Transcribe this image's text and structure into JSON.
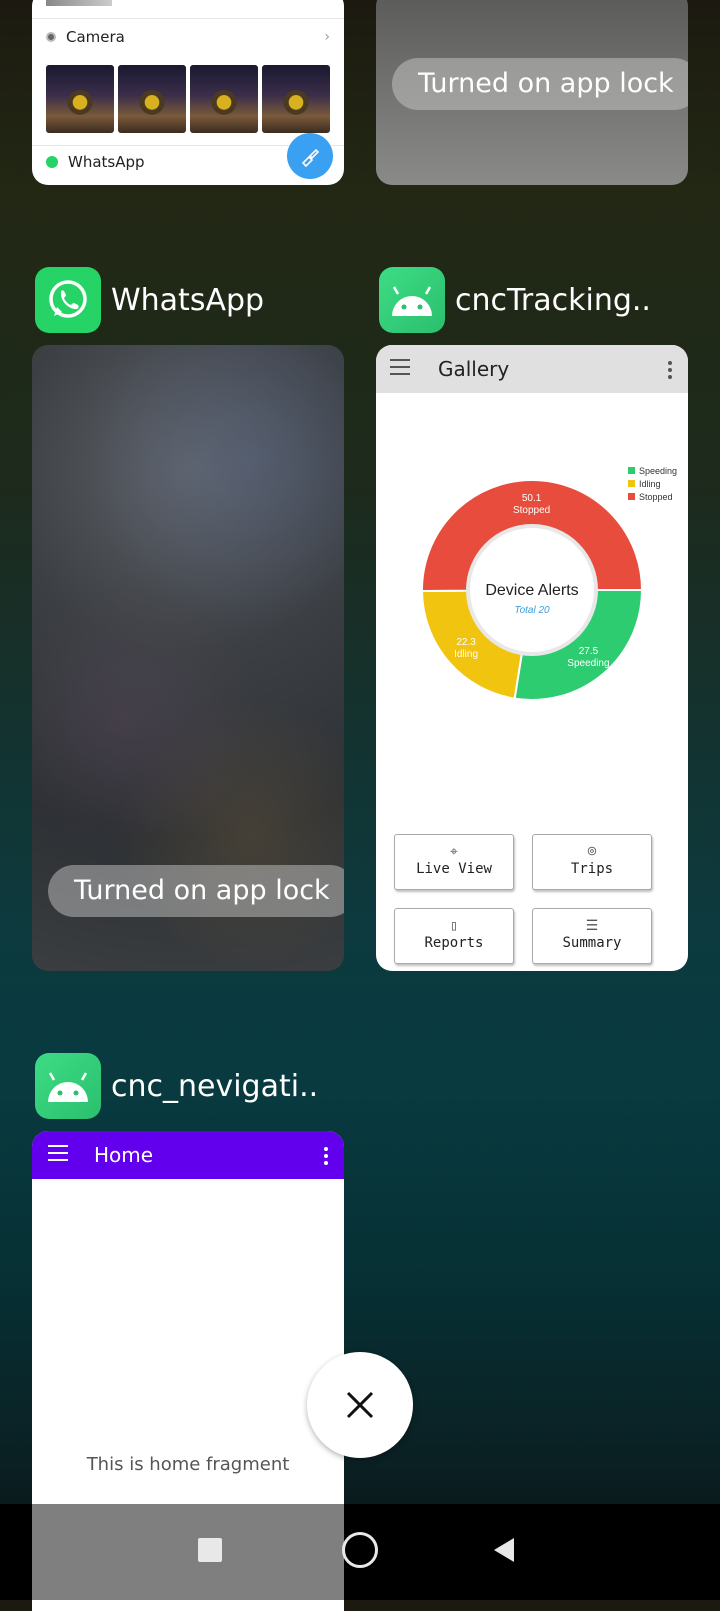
{
  "recent_apps": {
    "top_left_card": {
      "rows": [
        {
          "label": "Camera"
        },
        {
          "label": "WhatsApp"
        }
      ]
    },
    "top_right_card": {
      "lock_text": "Turned on app lock"
    },
    "whatsapp": {
      "title": "WhatsApp",
      "lock_text": "Turned on app lock",
      "icon": "whatsapp-icon",
      "color": "#25D366"
    },
    "cnc_tracking": {
      "title": "cncTracking..",
      "icon": "android-icon",
      "toolbar_title": "Gallery",
      "buttons": [
        {
          "label": "Live View",
          "icon": "crosshair-icon"
        },
        {
          "label": "Trips",
          "icon": "location-pin-icon"
        },
        {
          "label": "Reports",
          "icon": "document-icon"
        },
        {
          "label": "Summary",
          "icon": "list-icon"
        }
      ]
    },
    "cnc_navigation": {
      "title": "cnc_nevigati..",
      "icon": "android-icon",
      "toolbar_title": "Home",
      "toolbar_color": "#6200EE",
      "body_text": "This is home fragment"
    }
  },
  "chart_data": {
    "type": "pie",
    "title": "Device Alerts",
    "subtitle": "Total 20",
    "slices": [
      {
        "name": "Stopped",
        "value": 50.1,
        "color": "#E74C3C"
      },
      {
        "name": "Speeding",
        "value": 27.5,
        "color": "#2ECC71"
      },
      {
        "name": "Idling",
        "value": 22.3,
        "color": "#F1C40F"
      }
    ],
    "legend": [
      "Speeding",
      "Idling",
      "Stopped"
    ],
    "legend_placement": "top-right",
    "donut": true
  },
  "clear_all_icon": "close-icon",
  "navigation_bar": {
    "recents_icon": "square-icon",
    "home_icon": "circle-icon",
    "back_icon": "triangle-back-icon"
  }
}
